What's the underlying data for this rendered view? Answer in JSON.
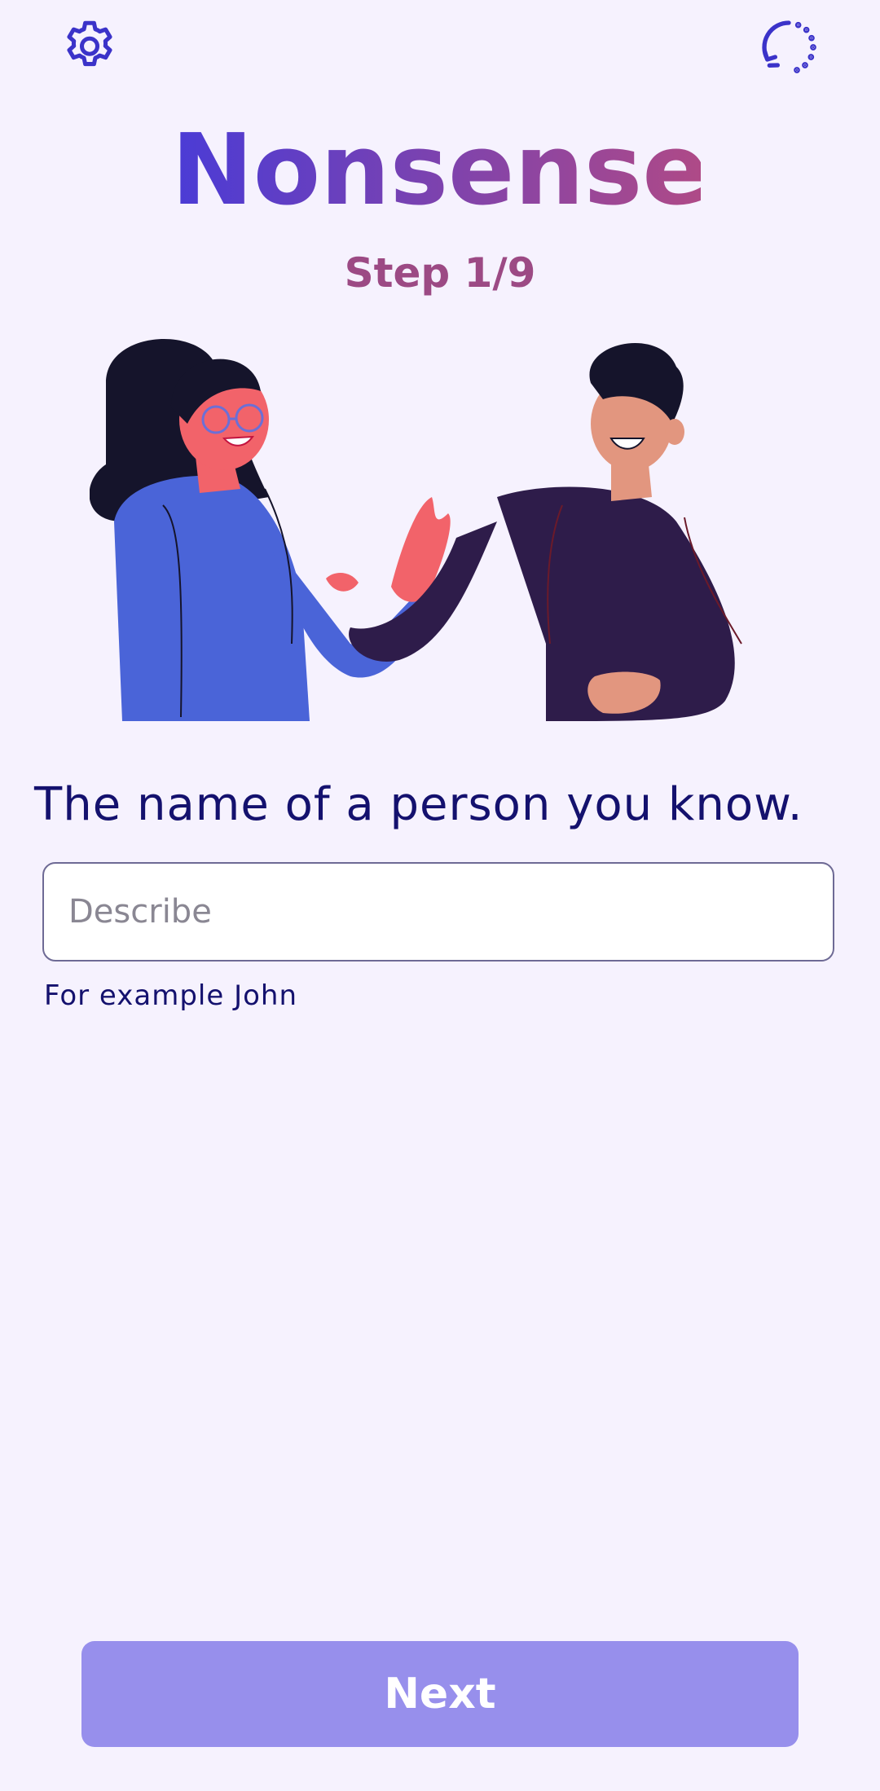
{
  "app": {
    "title": "Nonsense",
    "step_label": "Step 1/9"
  },
  "icons": {
    "settings": "gear-icon",
    "reset": "restart-icon"
  },
  "question": {
    "prompt": "The name of a person you know.",
    "input_value": "",
    "input_placeholder": "Describe",
    "hint": "For example John"
  },
  "actions": {
    "next_label": "Next"
  },
  "colors": {
    "background": "#f6f2fe",
    "icon": "#3b33c9",
    "title_gradient_start": "#4a3bd6",
    "title_gradient_end": "#b04a86",
    "step": "#9c4a84",
    "text": "#14116e",
    "button": "#978fec"
  }
}
